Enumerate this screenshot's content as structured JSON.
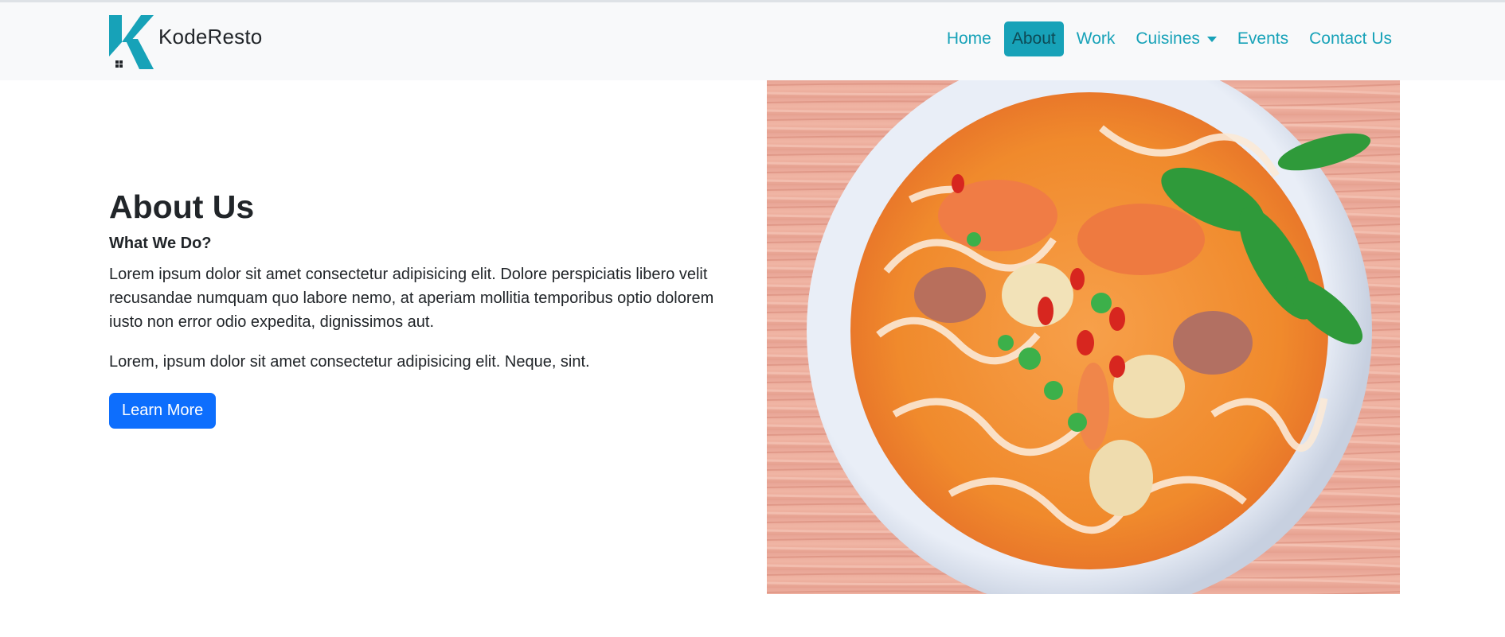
{
  "brand": {
    "name": "KodeResto",
    "logo_color": "#17a2b8"
  },
  "nav": {
    "items": [
      {
        "label": "Home",
        "active": false
      },
      {
        "label": "About",
        "active": true
      },
      {
        "label": "Work",
        "active": false
      },
      {
        "label": "Cuisines",
        "active": false,
        "dropdown": true
      },
      {
        "label": "Events",
        "active": false
      },
      {
        "label": "Contact Us",
        "active": false
      }
    ]
  },
  "about": {
    "title": "About Us",
    "subtitle": "What We Do?",
    "paragraph1": "Lorem ipsum dolor sit amet consectetur adipisicing elit. Dolore perspiciatis libero velit recusandae numquam quo labore nemo, at aperiam mollitia temporibus optio dolorem iusto non error odio expedita, dignissimos aut.",
    "paragraph2": "Lorem, ipsum dolor sit amet consectetur adipisicing elit. Neque, sint.",
    "button_label": "Learn More"
  },
  "colors": {
    "accent": "#17a2b8",
    "primary_button": "#0d6efd",
    "navbar_bg": "#f8f9fa"
  },
  "image": {
    "subject": "noodle-soup-bowl"
  }
}
